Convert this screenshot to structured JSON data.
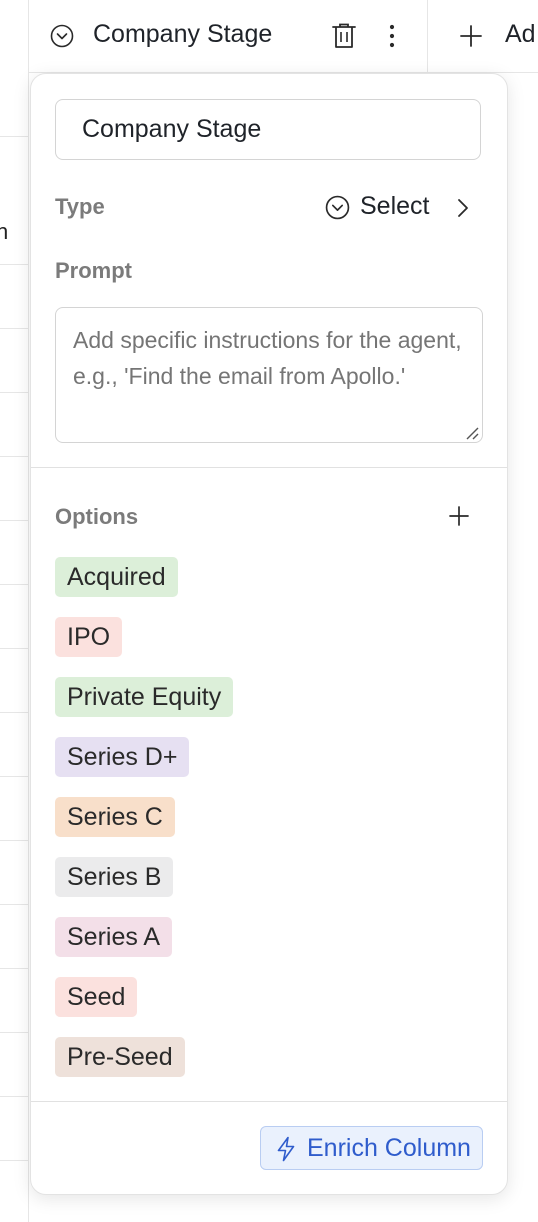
{
  "background": {
    "cell_fragment": "n"
  },
  "column_header": {
    "title": "Company Stage",
    "add_label": "Ad"
  },
  "panel": {
    "name_value": "Company Stage",
    "type_label": "Type",
    "type_value": "Select",
    "prompt_label": "Prompt",
    "prompt_placeholder": "Add specific instructions for the agent, e.g., 'Find the email from Apollo.'",
    "options_label": "Options",
    "options": [
      {
        "label": "Acquired",
        "color": "#dcefd9"
      },
      {
        "label": "IPO",
        "color": "#fbe1de"
      },
      {
        "label": "Private Equity",
        "color": "#dcefd9"
      },
      {
        "label": "Series D+",
        "color": "#e6e0f2"
      },
      {
        "label": "Series C",
        "color": "#f8dfca"
      },
      {
        "label": "Series B",
        "color": "#ebebec"
      },
      {
        "label": "Series A",
        "color": "#f3dfe8"
      },
      {
        "label": "Seed",
        "color": "#fbe1de"
      },
      {
        "label": "Pre-Seed",
        "color": "#eee1da"
      }
    ],
    "enrich_label": "Enrich Column",
    "accent_color": "#2f5ccc"
  }
}
